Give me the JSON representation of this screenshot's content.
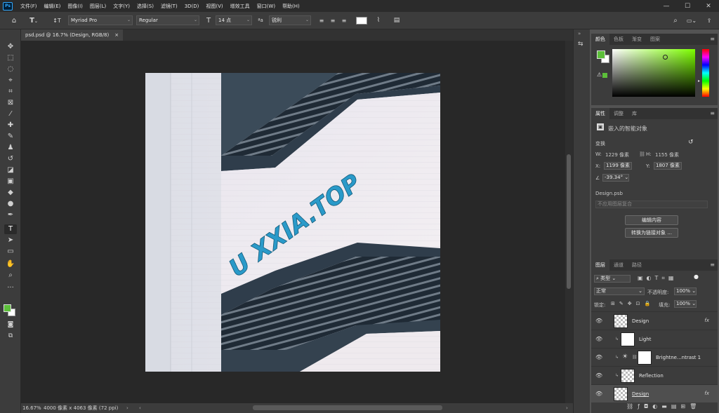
{
  "menubar": {
    "logo": "Ps",
    "items": [
      "文件(F)",
      "编辑(E)",
      "图像(I)",
      "图层(L)",
      "文字(Y)",
      "选择(S)",
      "滤镜(T)",
      "3D(D)",
      "视图(V)",
      "增效工具",
      "窗口(W)",
      "帮助(H)"
    ],
    "minimize": "—",
    "maximize": "☐",
    "close": "✕"
  },
  "options": {
    "font_family": "Myriad Pro",
    "font_style": "Regular",
    "font_size": "14 点",
    "antialias": "锐利"
  },
  "document": {
    "tab_title": "psd.psd @ 16.7% (Design, RGB/8)",
    "tab_close": "×",
    "artwork_text": "U XXIA.TOP",
    "zoom": "16.67%",
    "doc_info": "4000 像素 x 4063 像素 (72 ppi)"
  },
  "color_panel": {
    "tabs": [
      "颜色",
      "色板",
      "渐变",
      "图案"
    ],
    "foreground_color": "#5cbf3a",
    "background_color": "#ffffff",
    "hue_color": "#7dff00"
  },
  "properties_panel": {
    "tabs": [
      "属性",
      "调整",
      "库"
    ],
    "object_type": "嵌入的智能对象",
    "transform_label": "变换",
    "w_label": "W:",
    "w_value": "1229 像素",
    "h_label": "H:",
    "h_value": "1155 像素",
    "x_label": "X:",
    "x_value": "1199 像素",
    "y_label": "Y:",
    "y_value": "1807 像素",
    "angle_value": "-39.34°",
    "file_name": "Design.psb",
    "comp_placeholder": "不应用图层复合",
    "edit_contents_button": "编辑内容",
    "convert_button": "转换为链接对象 ..."
  },
  "layers_panel": {
    "tabs": [
      "图层",
      "通道",
      "路径"
    ],
    "filter_kind": "类型",
    "blend_mode": "正常",
    "opacity_label": "不透明度:",
    "opacity_value": "100%",
    "lock_label": "锁定:",
    "fill_label": "填充:",
    "fill_value": "100%",
    "layers": [
      {
        "name": "Design",
        "fx": "fx",
        "selected": false
      },
      {
        "name": "Light",
        "fx": "",
        "selected": false
      },
      {
        "name": "Brightne...ntrast 1",
        "fx": "",
        "selected": false
      },
      {
        "name": "Reflection",
        "fx": "",
        "selected": false
      },
      {
        "name": "Design",
        "fx": "fx",
        "selected": true
      }
    ]
  }
}
